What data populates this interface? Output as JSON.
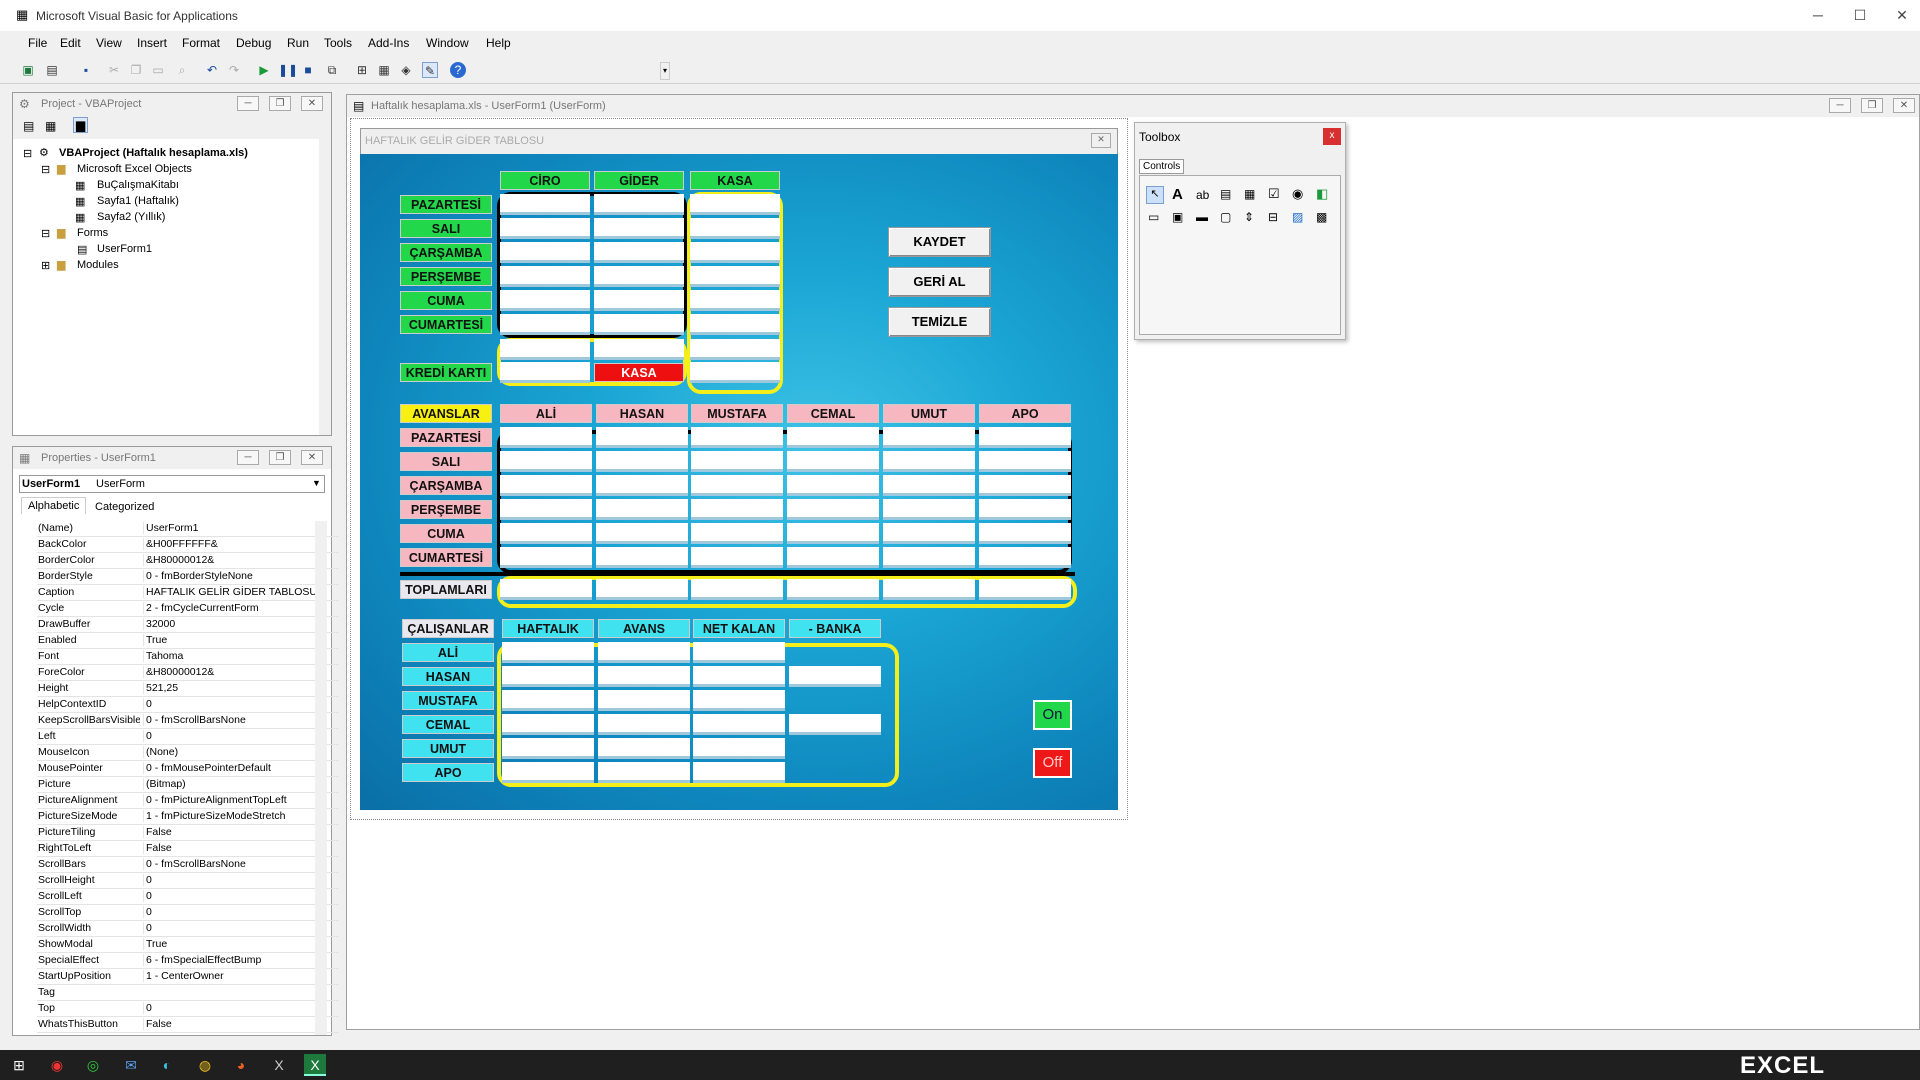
{
  "app": {
    "title": "Microsoft Visual Basic for Applications",
    "min": "─",
    "max": "☐",
    "close": "✕"
  },
  "menu": [
    "File",
    "Edit",
    "View",
    "Insert",
    "Format",
    "Debug",
    "Run",
    "Tools",
    "Add-Ins",
    "Window",
    "Help"
  ],
  "project": {
    "title": "Project - VBAProject",
    "root": "VBAProject (Haftalık hesaplama.xls)",
    "excel_objects": "Microsoft Excel Objects",
    "items": [
      "BuÇalışmaKitabı",
      "Sayfa1 (Haftalık)",
      "Sayfa2 (Yıllık)"
    ],
    "forms": "Forms",
    "form1": "UserForm1",
    "modules": "Modules"
  },
  "properties": {
    "title": "Properties - UserForm1",
    "object": "UserForm1",
    "object_type": "UserForm",
    "tabs": [
      "Alphabetic",
      "Categorized"
    ],
    "rows": [
      [
        "(Name)",
        "UserForm1"
      ],
      [
        "BackColor",
        "&H00FFFFFF&"
      ],
      [
        "BorderColor",
        "&H80000012&"
      ],
      [
        "BorderStyle",
        "0 - fmBorderStyleNone"
      ],
      [
        "Caption",
        "HAFTALIK GELİR GİDER TABLOSU"
      ],
      [
        "Cycle",
        "2 - fmCycleCurrentForm"
      ],
      [
        "DrawBuffer",
        "32000"
      ],
      [
        "Enabled",
        "True"
      ],
      [
        "Font",
        "Tahoma"
      ],
      [
        "ForeColor",
        "&H80000012&"
      ],
      [
        "Height",
        "521,25"
      ],
      [
        "HelpContextID",
        "0"
      ],
      [
        "KeepScrollBarsVisible",
        "0 - fmScrollBarsNone"
      ],
      [
        "Left",
        "0"
      ],
      [
        "MouseIcon",
        "(None)"
      ],
      [
        "MousePointer",
        "0 - fmMousePointerDefault"
      ],
      [
        "Picture",
        "(Bitmap)"
      ],
      [
        "PictureAlignment",
        "0 - fmPictureAlignmentTopLeft"
      ],
      [
        "PictureSizeMode",
        "1 - fmPictureSizeModeStretch"
      ],
      [
        "PictureTiling",
        "False"
      ],
      [
        "RightToLeft",
        "False"
      ],
      [
        "ScrollBars",
        "0 - fmScrollBarsNone"
      ],
      [
        "ScrollHeight",
        "0"
      ],
      [
        "ScrollLeft",
        "0"
      ],
      [
        "ScrollTop",
        "0"
      ],
      [
        "ScrollWidth",
        "0"
      ],
      [
        "ShowModal",
        "True"
      ],
      [
        "SpecialEffect",
        "6 - fmSpecialEffectBump"
      ],
      [
        "StartUpPosition",
        "1 - CenterOwner"
      ],
      [
        "Tag",
        ""
      ],
      [
        "Top",
        "0"
      ],
      [
        "WhatsThisButton",
        "False"
      ]
    ]
  },
  "formwin": {
    "title": "Haftalık hesaplama.xls - UserForm1 (UserForm)"
  },
  "userform": {
    "caption": "HAFTALIK GELİR GİDER TABLOSU",
    "close": "✕",
    "section1": {
      "headers": [
        "CİRO",
        "GİDER",
        "KASA"
      ],
      "days": [
        "PAZARTESİ",
        "SALI",
        "ÇARŞAMBA",
        "PERŞEMBE",
        "CUMA",
        "CUMARTESİ"
      ],
      "kredi": "KREDİ KARTI",
      "kasa": "KASA"
    },
    "buttons": {
      "save": "KAYDET",
      "undo": "GERİ AL",
      "clear": "TEMİZLE"
    },
    "section2": {
      "title": "AVANSLAR",
      "people": [
        "ALİ",
        "HASAN",
        "MUSTAFA",
        "CEMAL",
        "UMUT",
        "APO"
      ],
      "days": [
        "PAZARTESİ",
        "SALI",
        "ÇARŞAMBA",
        "PERŞEMBE",
        "CUMA",
        "CUMARTESİ"
      ],
      "total": "TOPLAMLARI"
    },
    "section3": {
      "title": "ÇALIŞANLAR",
      "headers": [
        "HAFTALIK",
        "AVANS",
        "NET KALAN",
        "- BANKA"
      ],
      "people": [
        "ALİ",
        "HASAN",
        "MUSTAFA",
        "CEMAL",
        "UMUT",
        "APO"
      ]
    },
    "on": "On",
    "off": "Off"
  },
  "toolbox": {
    "title": "Toolbox",
    "tab": "Controls",
    "close": "x"
  },
  "taskbar": {
    "brand": "EXCEL"
  }
}
